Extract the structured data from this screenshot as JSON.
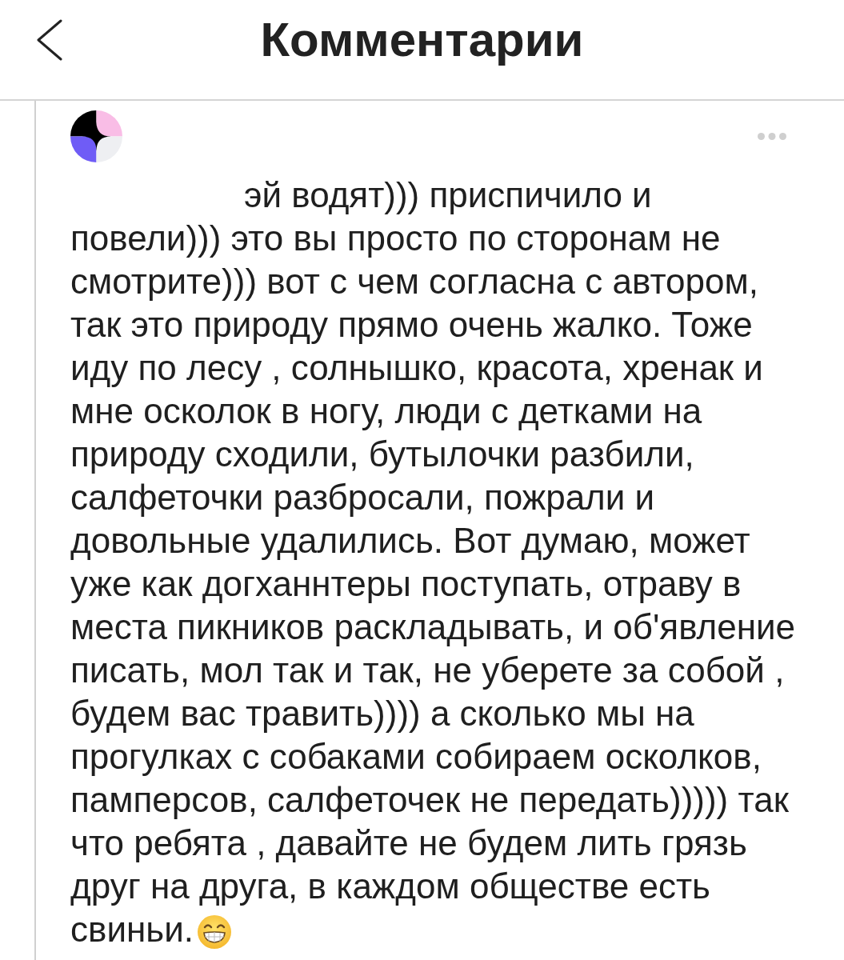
{
  "header": {
    "title": "Комментарии"
  },
  "comment": {
    "lines": [
      "эй водят))) приспичило и",
      "повели))) это вы просто по сторонам не",
      "смотрите))) вот с чем согласна с автором,",
      "так это природу прямо очень жалко. Тоже",
      "иду по лесу , солнышко, красота, хренак и",
      "мне осколок в ногу, люди с детками на",
      "природу сходили, бутылочки разбили,",
      "салфеточки разбросали, пожрали и",
      "довольные удалились. Вот думаю, может",
      "уже как догханнтеры поступать, отраву в",
      "места пикников раскладывать, и об'явление",
      "писать, мол так и так, не уберете за собой ,",
      "будем вас травить)))) а сколько мы на",
      "прогулках с собаками собираем осколков,",
      "памперсов, салфеточек не передать))))) так",
      "что ребята , давайте не будем лить грязь",
      "друг на друга, в каждом обществе есть",
      "свиньи."
    ]
  }
}
